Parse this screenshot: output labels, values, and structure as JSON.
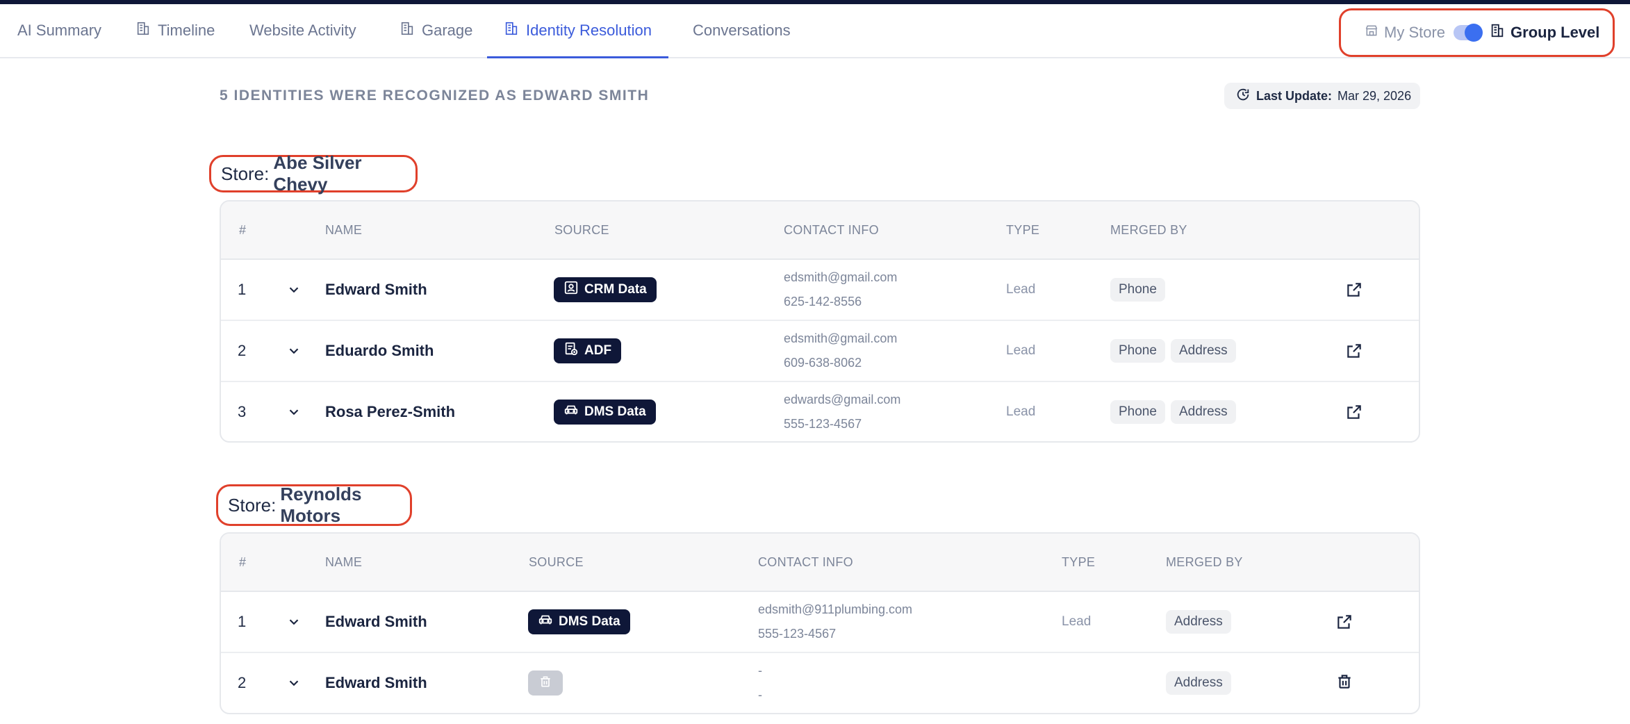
{
  "tabs": [
    {
      "label": "AI Summary",
      "icon": "none",
      "active": false
    },
    {
      "label": "Timeline",
      "icon": "building-icon",
      "active": false
    },
    {
      "label": "Website Activity",
      "icon": "none",
      "active": false
    },
    {
      "label": "Garage",
      "icon": "building-icon",
      "active": false
    },
    {
      "label": "Identity Resolution",
      "icon": "building-icon",
      "active": true
    },
    {
      "label": "Conversations",
      "icon": "none",
      "active": false
    }
  ],
  "scope_toggle": {
    "left_label": "My Store",
    "right_label": "Group Level",
    "selected": "Group Level"
  },
  "heading": "5 IDENTITIES WERE RECOGNIZED AS EDWARD SMITH",
  "last_update": {
    "label": "Last Update:",
    "value": "Mar 29, 2026"
  },
  "stores": [
    {
      "prefix": "Store:",
      "name": "Abe Silver Chevy",
      "columns": [
        "#",
        "NAME",
        "SOURCE",
        "CONTACT INFO",
        "TYPE",
        "MERGED BY"
      ],
      "rows": [
        {
          "num": "1",
          "name": "Edward Smith",
          "source": "CRM Data",
          "source_icon": "contact-card-icon",
          "email": "edsmith@gmail.com",
          "phone": "625-142-8556",
          "type": "Lead",
          "merged_by": [
            "Phone"
          ],
          "action": "external-link-icon"
        },
        {
          "num": "2",
          "name": "Eduardo Smith",
          "source": "ADF",
          "source_icon": "document-icon",
          "email": "edsmith@gmail.com",
          "phone": "609-638-8062",
          "type": "Lead",
          "merged_by": [
            "Phone",
            "Address"
          ],
          "action": "external-link-icon"
        },
        {
          "num": "3",
          "name": "Rosa Perez-Smith",
          "source": "DMS Data",
          "source_icon": "car-icon",
          "email": "edwards@gmail.com",
          "phone": "555-123-4567",
          "type": "Lead",
          "merged_by": [
            "Phone",
            "Address"
          ],
          "action": "external-link-icon"
        }
      ]
    },
    {
      "prefix": "Store:",
      "name": "Reynolds Motors",
      "columns": [
        "#",
        "NAME",
        "SOURCE",
        "CONTACT INFO",
        "TYPE",
        "MERGED BY"
      ],
      "rows": [
        {
          "num": "1",
          "name": "Edward Smith",
          "source": "DMS Data",
          "source_icon": "car-icon",
          "email": "edsmith@911plumbing.com",
          "phone": "555-123-4567",
          "type": "Lead",
          "merged_by": [
            "Address"
          ],
          "action": "external-link-icon"
        },
        {
          "num": "2",
          "name": "Edward Smith",
          "source": "",
          "source_icon": "trash-icon",
          "email": "-",
          "phone": "-",
          "type": "",
          "merged_by": [
            "Address"
          ],
          "action": "trash-icon"
        }
      ]
    }
  ],
  "colors": {
    "accent": "#3b5bdb",
    "badge": "#0f1738",
    "highlight": "#e0402b"
  }
}
